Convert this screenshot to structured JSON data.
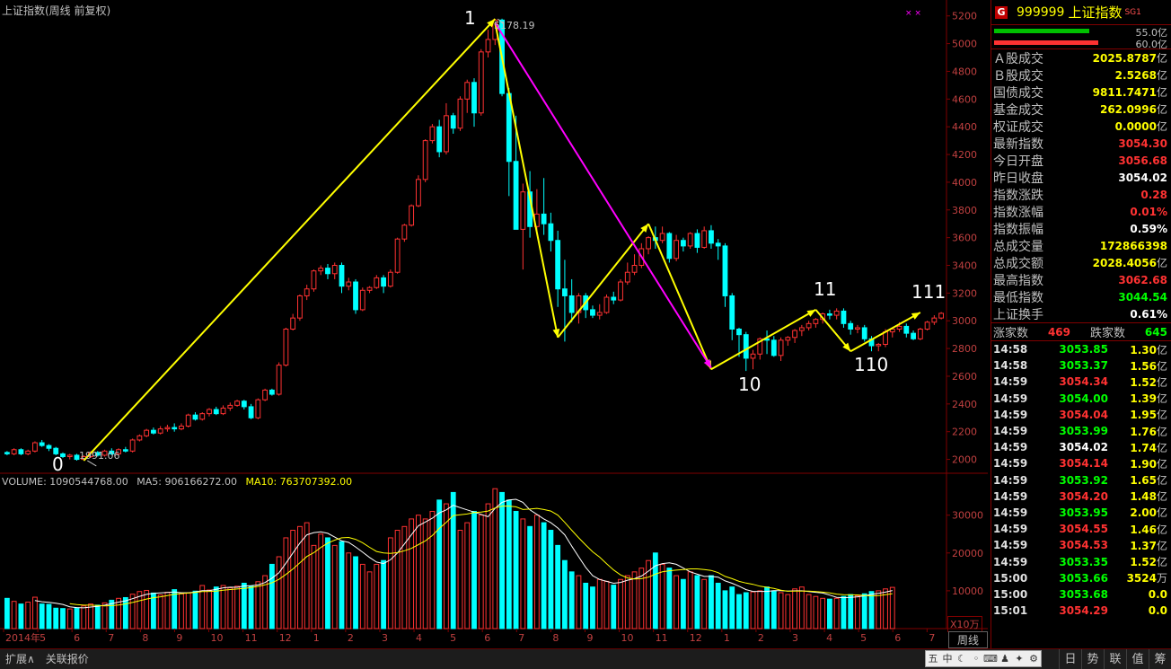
{
  "chart_title": "上证指数(周线 前复权)",
  "price_axis": [
    "5200",
    "5000",
    "4800",
    "4600",
    "4400",
    "4200",
    "4000",
    "3800",
    "3600",
    "3400",
    "3200",
    "3000",
    "2800",
    "2600",
    "2400",
    "2200",
    "2000"
  ],
  "vol_axis": [
    "30000",
    "20000",
    "10000"
  ],
  "x10_unit": "X10万",
  "month_labels": [
    "2014年",
    "5",
    "6",
    "7",
    "8",
    "9",
    "10",
    "11",
    "12",
    "1",
    "2",
    "3",
    "4",
    "5",
    "6",
    "7",
    "8",
    "9",
    "10",
    "11",
    "12",
    "1",
    "2",
    "3",
    "4",
    "5",
    "6",
    "7"
  ],
  "high_label": "5178.19",
  "low_label": "1991.06",
  "wave_labels": {
    "w0": "0",
    "w1": "1",
    "w10": "10",
    "w11": "11",
    "w110": "110",
    "w111": "111"
  },
  "volume": {
    "vol": "VOLUME: 1090544768.00",
    "ma5": "MA5: 906166272.00",
    "ma10": "MA10: 763707392.00"
  },
  "colors": {
    "up": "#ff3232",
    "down": "#00ffff",
    "ma5": "#ffffff",
    "ma10": "#ffff00",
    "trend": "#ffff00",
    "magenta": "#ff00ff",
    "grid": "#800000"
  },
  "panel": {
    "badge": "G",
    "code": "999999",
    "name": "上证指数",
    "sg": "SG1",
    "bars": [
      {
        "val": "55.0亿",
        "color": "#00c000",
        "fill": 0.76
      },
      {
        "val": "60.0亿",
        "color": "#ff3232",
        "fill": 0.83
      }
    ],
    "info": [
      {
        "label": "Ａ股成交",
        "value": "2025.8787",
        "unit": "亿",
        "color": "#ffff00"
      },
      {
        "label": "Ｂ股成交",
        "value": "2.5268",
        "unit": "亿",
        "color": "#ffff00"
      },
      {
        "label": "国债成交",
        "value": "9811.7471",
        "unit": "亿",
        "color": "#ffff00"
      },
      {
        "label": "基金成交",
        "value": "262.0996",
        "unit": "亿",
        "color": "#ffff00"
      },
      {
        "label": "权证成交",
        "value": "0.0000",
        "unit": "亿",
        "color": "#ffff00"
      },
      {
        "label": "最新指数",
        "value": "3054.30",
        "unit": "",
        "color": "#ff3232"
      },
      {
        "label": "今日开盘",
        "value": "3056.68",
        "unit": "",
        "color": "#ff3232"
      },
      {
        "label": "昨日收盘",
        "value": "3054.02",
        "unit": "",
        "color": "#ffffff"
      },
      {
        "label": "指数涨跌",
        "value": "0.28",
        "unit": "",
        "color": "#ff3232"
      },
      {
        "label": "指数涨幅",
        "value": "0.01%",
        "unit": "",
        "color": "#ff3232"
      },
      {
        "label": "指数振幅",
        "value": "0.59%",
        "unit": "",
        "color": "#ffffff"
      },
      {
        "label": "总成交量",
        "value": "172866398",
        "unit": "",
        "color": "#ffff00"
      },
      {
        "label": "总成交额",
        "value": "2028.4056",
        "unit": "亿",
        "color": "#ffff00"
      },
      {
        "label": "最高指数",
        "value": "3062.68",
        "unit": "",
        "color": "#ff3232"
      },
      {
        "label": "最低指数",
        "value": "3044.54",
        "unit": "",
        "color": "#00ff00"
      },
      {
        "label": "上证换手",
        "value": "0.61%",
        "unit": "",
        "color": "#ffffff"
      }
    ],
    "updown": {
      "up_label": "涨家数",
      "up_val": "469",
      "down_label": "跌家数",
      "down_val": "645"
    },
    "ticks": [
      {
        "t": "14:58",
        "p": "3053.85",
        "c": "#00ff00",
        "v": "1.30",
        "u": "亿"
      },
      {
        "t": "14:58",
        "p": "3053.37",
        "c": "#00ff00",
        "v": "1.56",
        "u": "亿"
      },
      {
        "t": "14:59",
        "p": "3054.34",
        "c": "#ff3232",
        "v": "1.52",
        "u": "亿"
      },
      {
        "t": "14:59",
        "p": "3054.00",
        "c": "#00ff00",
        "v": "1.39",
        "u": "亿"
      },
      {
        "t": "14:59",
        "p": "3054.04",
        "c": "#ff3232",
        "v": "1.95",
        "u": "亿"
      },
      {
        "t": "14:59",
        "p": "3053.99",
        "c": "#00ff00",
        "v": "1.76",
        "u": "亿"
      },
      {
        "t": "14:59",
        "p": "3054.02",
        "c": "#ffffff",
        "v": "1.74",
        "u": "亿"
      },
      {
        "t": "14:59",
        "p": "3054.14",
        "c": "#ff3232",
        "v": "1.90",
        "u": "亿"
      },
      {
        "t": "14:59",
        "p": "3053.92",
        "c": "#00ff00",
        "v": "1.65",
        "u": "亿"
      },
      {
        "t": "14:59",
        "p": "3054.20",
        "c": "#ff3232",
        "v": "1.48",
        "u": "亿"
      },
      {
        "t": "14:59",
        "p": "3053.95",
        "c": "#00ff00",
        "v": "2.00",
        "u": "亿"
      },
      {
        "t": "14:59",
        "p": "3054.55",
        "c": "#ff3232",
        "v": "1.46",
        "u": "亿"
      },
      {
        "t": "14:59",
        "p": "3054.53",
        "c": "#ff3232",
        "v": "1.37",
        "u": "亿"
      },
      {
        "t": "14:59",
        "p": "3053.35",
        "c": "#00ff00",
        "v": "1.52",
        "u": "亿"
      },
      {
        "t": "15:00",
        "p": "3053.66",
        "c": "#00ff00",
        "v": "3524",
        "u": "万"
      },
      {
        "t": "15:00",
        "p": "3053.68",
        "c": "#00ff00",
        "v": "0.0",
        "u": ""
      },
      {
        "t": "15:01",
        "p": "3054.29",
        "c": "#ff3232",
        "v": "0.0",
        "u": ""
      }
    ]
  },
  "bottom": {
    "expand": "扩展∧",
    "related": "关联报价",
    "weekly": "周线",
    "right_tabs": [
      "日",
      "势",
      "联",
      "值",
      "筹"
    ]
  },
  "ime": [
    "五",
    "中",
    "☾",
    "◦",
    "⌨",
    "♟",
    "✦",
    "⚙"
  ],
  "chart_data": {
    "type": "candlestick",
    "title": "上证指数(周线 前复权)",
    "candles": [
      [
        2050,
        2040,
        2060,
        2030
      ],
      [
        2040,
        2070,
        2080,
        2030
      ],
      [
        2070,
        2040,
        2080,
        2030
      ],
      [
        2040,
        2060,
        2070,
        2030
      ],
      [
        2060,
        2120,
        2130,
        2050
      ],
      [
        2120,
        2100,
        2140,
        2090
      ],
      [
        2100,
        2080,
        2110,
        2060
      ],
      [
        2080,
        2040,
        2090,
        2030
      ],
      [
        2040,
        2020,
        2050,
        2010
      ],
      [
        2020,
        2030,
        2040,
        2000
      ],
      [
        2030,
        2000,
        2040,
        1991
      ],
      [
        2000,
        2020,
        2030,
        1995
      ],
      [
        2020,
        2050,
        2060,
        2010
      ],
      [
        2050,
        2030,
        2060,
        2020
      ],
      [
        2030,
        2060,
        2070,
        2020
      ],
      [
        2060,
        2040,
        2080,
        2030
      ],
      [
        2040,
        2070,
        2080,
        2030
      ],
      [
        2070,
        2060,
        2090,
        2050
      ],
      [
        2060,
        2140,
        2150,
        2050
      ],
      [
        2140,
        2170,
        2180,
        2130
      ],
      [
        2170,
        2210,
        2220,
        2160
      ],
      [
        2210,
        2190,
        2230,
        2180
      ],
      [
        2190,
        2220,
        2240,
        2180
      ],
      [
        2220,
        2230,
        2250,
        2200
      ],
      [
        2230,
        2220,
        2260,
        2200
      ],
      [
        2220,
        2240,
        2260,
        2210
      ],
      [
        2240,
        2320,
        2330,
        2230
      ],
      [
        2320,
        2290,
        2340,
        2280
      ],
      [
        2290,
        2330,
        2340,
        2280
      ],
      [
        2330,
        2360,
        2370,
        2310
      ],
      [
        2360,
        2330,
        2380,
        2320
      ],
      [
        2330,
        2370,
        2390,
        2320
      ],
      [
        2370,
        2390,
        2410,
        2350
      ],
      [
        2390,
        2420,
        2430,
        2380
      ],
      [
        2420,
        2380,
        2430,
        2360
      ],
      [
        2380,
        2300,
        2400,
        2290
      ],
      [
        2300,
        2430,
        2440,
        2290
      ],
      [
        2430,
        2500,
        2510,
        2420
      ],
      [
        2500,
        2470,
        2510,
        2460
      ],
      [
        2470,
        2680,
        2700,
        2460
      ],
      [
        2680,
        2940,
        2950,
        2670
      ],
      [
        2940,
        3020,
        3050,
        2930
      ],
      [
        3020,
        3180,
        3190,
        3000
      ],
      [
        3180,
        3230,
        3260,
        3150
      ],
      [
        3230,
        3360,
        3370,
        3210
      ],
      [
        3360,
        3380,
        3400,
        3330
      ],
      [
        3380,
        3340,
        3410,
        3300
      ],
      [
        3340,
        3400,
        3420,
        3300
      ],
      [
        3400,
        3250,
        3420,
        3200
      ],
      [
        3250,
        3280,
        3310,
        3220
      ],
      [
        3280,
        3080,
        3300,
        3050
      ],
      [
        3080,
        3220,
        3240,
        3070
      ],
      [
        3220,
        3240,
        3250,
        3200
      ],
      [
        3240,
        3310,
        3330,
        3230
      ],
      [
        3310,
        3250,
        3330,
        3200
      ],
      [
        3250,
        3350,
        3370,
        3240
      ],
      [
        3350,
        3590,
        3600,
        3340
      ],
      [
        3590,
        3690,
        3700,
        3570
      ],
      [
        3690,
        3830,
        3840,
        3680
      ],
      [
        3830,
        4020,
        4050,
        3820
      ],
      [
        4020,
        4300,
        4310,
        4000
      ],
      [
        4300,
        4400,
        4420,
        4280
      ],
      [
        4400,
        4220,
        4450,
        4180
      ],
      [
        4220,
        4480,
        4570,
        4200
      ],
      [
        4480,
        4390,
        4500,
        4350
      ],
      [
        4390,
        4600,
        4620,
        4370
      ],
      [
        4600,
        4720,
        4740,
        4500
      ],
      [
        4720,
        4500,
        4750,
        4400
      ],
      [
        4500,
        4940,
        4960,
        4480
      ],
      [
        4940,
        5030,
        5100,
        4900
      ],
      [
        5030,
        5170,
        5178,
        4990
      ],
      [
        5170,
        4640,
        5180,
        4620
      ],
      [
        4640,
        4150,
        4680,
        3900
      ],
      [
        4150,
        3660,
        4480,
        3700
      ],
      [
        3660,
        3930,
        3990,
        3370
      ],
      [
        3930,
        3680,
        4080,
        3600
      ],
      [
        3680,
        3770,
        3950,
        3640
      ],
      [
        3770,
        3700,
        4030,
        3620
      ],
      [
        3700,
        3580,
        3780,
        3500
      ],
      [
        3580,
        3230,
        3650,
        3100
      ],
      [
        3230,
        3180,
        3440,
        2850
      ],
      [
        3180,
        3060,
        3300,
        2990
      ],
      [
        3060,
        3180,
        3200,
        2980
      ],
      [
        3180,
        3080,
        3200,
        3020
      ],
      [
        3080,
        3040,
        3110,
        3020
      ],
      [
        3040,
        3060,
        3120,
        3010
      ],
      [
        3060,
        3170,
        3190,
        3050
      ],
      [
        3170,
        3150,
        3210,
        3120
      ],
      [
        3150,
        3280,
        3300,
        3140
      ],
      [
        3280,
        3350,
        3420,
        3260
      ],
      [
        3350,
        3400,
        3480,
        3330
      ],
      [
        3400,
        3520,
        3560,
        3380
      ],
      [
        3520,
        3600,
        3610,
        3480
      ],
      [
        3600,
        3580,
        3680,
        3520
      ],
      [
        3580,
        3630,
        3680,
        3560
      ],
      [
        3630,
        3450,
        3640,
        3420
      ],
      [
        3450,
        3580,
        3620,
        3430
      ],
      [
        3580,
        3540,
        3600,
        3500
      ],
      [
        3540,
        3630,
        3640,
        3520
      ],
      [
        3630,
        3530,
        3660,
        3490
      ],
      [
        3530,
        3650,
        3680,
        3520
      ],
      [
        3650,
        3560,
        3690,
        3520
      ],
      [
        3560,
        3540,
        3590,
        3440
      ],
      [
        3540,
        3180,
        3560,
        3100
      ],
      [
        3180,
        2940,
        3200,
        2860
      ],
      [
        2940,
        2900,
        2950,
        2740
      ],
      [
        2900,
        2730,
        2920,
        2638
      ],
      [
        2730,
        2760,
        2790,
        2650
      ],
      [
        2760,
        2870,
        2880,
        2720
      ],
      [
        2870,
        2860,
        2930,
        2760
      ],
      [
        2860,
        2750,
        2890,
        2740
      ],
      [
        2750,
        2860,
        2880,
        2710
      ],
      [
        2860,
        2880,
        2890,
        2820
      ],
      [
        2880,
        2930,
        2940,
        2840
      ],
      [
        2930,
        2950,
        2970,
        2890
      ],
      [
        2950,
        2980,
        3000,
        2930
      ],
      [
        2980,
        3010,
        3020,
        2950
      ],
      [
        3010,
        3050,
        3060,
        2980
      ],
      [
        3050,
        3040,
        3080,
        3010
      ],
      [
        3040,
        3070,
        3090,
        3010
      ],
      [
        3070,
        2980,
        3090,
        2950
      ],
      [
        2980,
        2940,
        3000,
        2900
      ],
      [
        2940,
        2950,
        2970,
        2910
      ],
      [
        2950,
        2870,
        2970,
        2850
      ],
      [
        2870,
        2820,
        2890,
        2780
      ],
      [
        2820,
        2830,
        2840,
        2780
      ],
      [
        2830,
        2920,
        2940,
        2810
      ],
      [
        2920,
        2940,
        2950,
        2880
      ],
      [
        2940,
        2960,
        2990,
        2920
      ],
      [
        2960,
        2910,
        2980,
        2880
      ],
      [
        2910,
        2870,
        2930,
        2860
      ],
      [
        2870,
        2940,
        2950,
        2860
      ],
      [
        2940,
        2990,
        3000,
        2930
      ],
      [
        2990,
        3020,
        3040,
        2970
      ],
      [
        3020,
        3054,
        3063,
        3010
      ]
    ],
    "volume": [
      8000,
      7200,
      6500,
      7000,
      8300,
      6500,
      6400,
      5400,
      5300,
      5200,
      5500,
      6000,
      6500,
      6200,
      6800,
      7500,
      8000,
      8200,
      9100,
      9800,
      10100,
      9400,
      8900,
      9600,
      10300,
      9200,
      9400,
      9900,
      11400,
      10200,
      11000,
      11400,
      10800,
      11200,
      12000,
      11300,
      12400,
      14000,
      17000,
      19000,
      24000,
      26000,
      27000,
      28000,
      22000,
      25000,
      24000,
      22000,
      23000,
      20000,
      19000,
      17000,
      15000,
      17000,
      18000,
      24000,
      26000,
      27000,
      29000,
      30000,
      29000,
      31000,
      34000,
      33000,
      36000,
      26000,
      28000,
      31000,
      30000,
      33000,
      37000,
      36000,
      34000,
      31000,
      29000,
      27000,
      30000,
      28000,
      26000,
      22000,
      18000,
      15000,
      14000,
      12000,
      11000,
      13000,
      12500,
      11500,
      13000,
      14000,
      15000,
      16000,
      18000,
      20000,
      17000,
      16000,
      14000,
      13000,
      15000,
      14000,
      13000,
      14000,
      12000,
      10000,
      11000,
      9000,
      9500,
      9700,
      10000,
      11000,
      10000,
      9500,
      9000,
      10500,
      11000,
      9000,
      8500,
      8000,
      7800,
      8000,
      8500,
      9000,
      8700,
      9200,
      9800,
      10000,
      10500,
      10900
    ],
    "price_range": [
      1900,
      5250
    ],
    "volume_max": 38000
  }
}
